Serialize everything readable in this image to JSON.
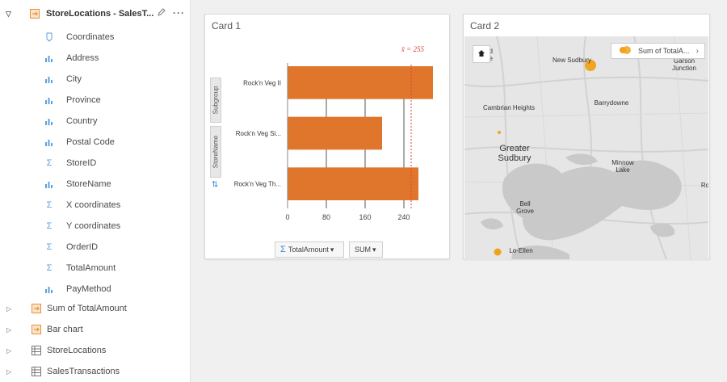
{
  "datapane": {
    "dataset_title": "StoreLocations - SalesT...",
    "more_label": "···",
    "fields": [
      {
        "label": "Coordinates",
        "icon": "location-icon"
      },
      {
        "label": "Address",
        "icon": "string-field-icon"
      },
      {
        "label": "City",
        "icon": "string-field-icon"
      },
      {
        "label": "Province",
        "icon": "string-field-icon"
      },
      {
        "label": "Country",
        "icon": "string-field-icon"
      },
      {
        "label": "Postal Code",
        "icon": "string-field-icon"
      },
      {
        "label": "StoreID",
        "icon": "number-field-icon"
      },
      {
        "label": "StoreName",
        "icon": "string-field-icon"
      },
      {
        "label": "X coordinates",
        "icon": "number-field-icon"
      },
      {
        "label": "Y coordinates",
        "icon": "number-field-icon"
      },
      {
        "label": "OrderID",
        "icon": "number-field-icon"
      },
      {
        "label": "TotalAmount",
        "icon": "number-field-icon"
      },
      {
        "label": "PayMethod",
        "icon": "string-field-icon"
      }
    ],
    "bottom_items": [
      {
        "label": "Sum of TotalAmount",
        "icon": "result-dataset-icon"
      },
      {
        "label": "Bar chart",
        "icon": "result-dataset-icon"
      },
      {
        "label": "StoreLocations",
        "icon": "table-icon"
      },
      {
        "label": "SalesTransactions",
        "icon": "table-icon"
      }
    ]
  },
  "card1": {
    "title": "Card 1",
    "subgroup_label": "Subgroup",
    "storename_label": "StoreName",
    "mean_label": "x̄ = 255",
    "amount_chip": "TotalAmount",
    "stat_chip": "SUM"
  },
  "card2": {
    "title": "Card 2",
    "legend_label": "Sum of TotalA...",
    "map_labels": [
      {
        "text": "od\nde"
      },
      {
        "text": "New Sudbury"
      },
      {
        "text": "Garson\nJunction"
      },
      {
        "text": "Cambrian Heights"
      },
      {
        "text": "Barrydowne"
      },
      {
        "text": "Greater\nSudbury"
      },
      {
        "text": "Minnow\nLake"
      },
      {
        "text": "Ro"
      },
      {
        "text": "Bell\nGrove"
      },
      {
        "text": "Lo-Ellen"
      }
    ]
  },
  "colors": {
    "bar": "#e0762b",
    "accent_blue": "#3a8bd6",
    "map_water": "#c9c9c9",
    "map_land": "#e6e6e6",
    "dot": "#f0a21a"
  },
  "chart_data": {
    "type": "bar",
    "orientation": "horizontal",
    "categories": [
      "Rock'n Veg II",
      "Rock'n Veg Si...",
      "Rock'n Veg Th..."
    ],
    "values": [
      300,
      195,
      270
    ],
    "x_ticks": [
      0,
      80,
      160,
      240
    ],
    "xlim": [
      0,
      300
    ],
    "mean": 255,
    "mean_label": "x̄ = 255",
    "title": "",
    "xlabel": "",
    "ylabel": ""
  }
}
